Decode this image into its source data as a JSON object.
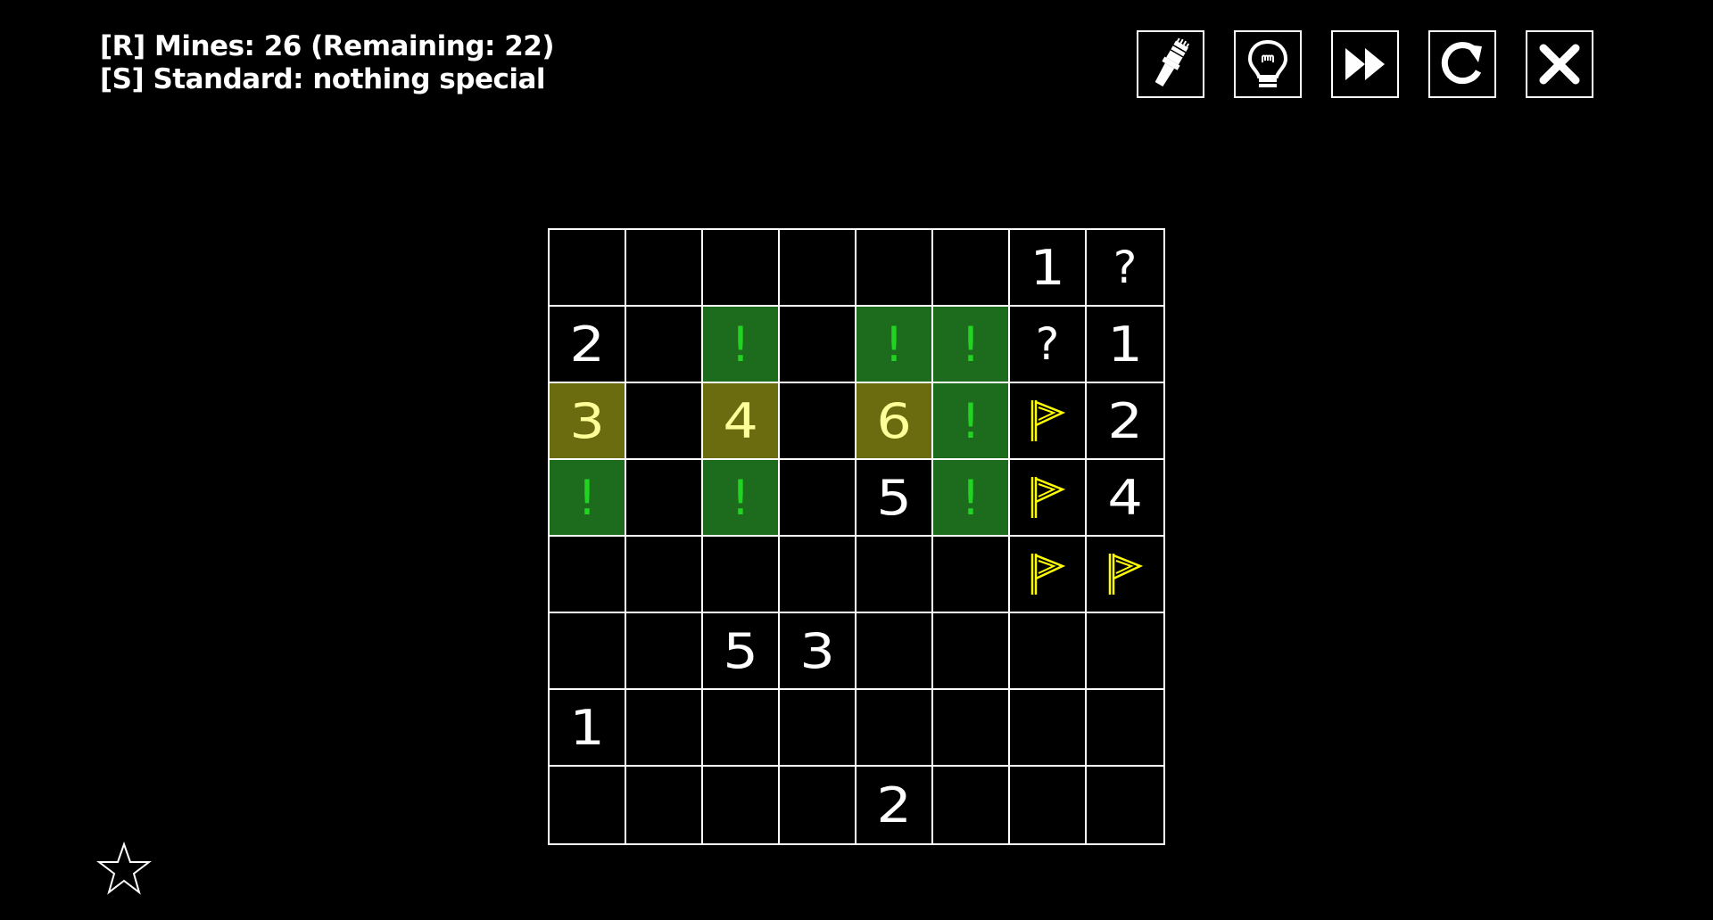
{
  "info": {
    "line1": "[R] Mines: 26 (Remaining: 22)",
    "line2": "[S] Standard: nothing special"
  },
  "toolbar": [
    {
      "name": "brush-button",
      "icon": "brush-icon"
    },
    {
      "name": "hint-button",
      "icon": "lightbulb-icon"
    },
    {
      "name": "skip-button",
      "icon": "fast-forward-icon"
    },
    {
      "name": "restart-button",
      "icon": "restart-icon"
    },
    {
      "name": "close-button",
      "icon": "close-icon"
    }
  ],
  "colors": {
    "background": "#000000",
    "grid": "#ffffff",
    "highlight_green": "#1d6b1d",
    "highlight_olive": "#6b6b10",
    "mark_green": "#22d422",
    "flag_yellow": "#ffff00",
    "number_highlight": "#ffff99"
  },
  "board": {
    "rows": 8,
    "cols": 8,
    "cells": [
      [
        {
          "t": ""
        },
        {
          "t": ""
        },
        {
          "t": ""
        },
        {
          "t": ""
        },
        {
          "t": ""
        },
        {
          "t": ""
        },
        {
          "t": "num",
          "v": "1"
        },
        {
          "t": "q",
          "v": "?"
        }
      ],
      [
        {
          "t": "num",
          "v": "2"
        },
        {
          "t": ""
        },
        {
          "t": "mark",
          "v": "!",
          "bg": "green"
        },
        {
          "t": ""
        },
        {
          "t": "mark",
          "v": "!",
          "bg": "green"
        },
        {
          "t": "mark",
          "v": "!",
          "bg": "green"
        },
        {
          "t": "q",
          "v": "?"
        },
        {
          "t": "num",
          "v": "1"
        }
      ],
      [
        {
          "t": "num",
          "v": "3",
          "bg": "olive"
        },
        {
          "t": ""
        },
        {
          "t": "num",
          "v": "4",
          "bg": "olive"
        },
        {
          "t": ""
        },
        {
          "t": "num",
          "v": "6",
          "bg": "olive"
        },
        {
          "t": "mark",
          "v": "!",
          "bg": "green"
        },
        {
          "t": "flag"
        },
        {
          "t": "num",
          "v": "2"
        }
      ],
      [
        {
          "t": "mark",
          "v": "!",
          "bg": "green"
        },
        {
          "t": ""
        },
        {
          "t": "mark",
          "v": "!",
          "bg": "green"
        },
        {
          "t": ""
        },
        {
          "t": "num",
          "v": "5"
        },
        {
          "t": "mark",
          "v": "!",
          "bg": "green"
        },
        {
          "t": "flag"
        },
        {
          "t": "num",
          "v": "4"
        }
      ],
      [
        {
          "t": ""
        },
        {
          "t": ""
        },
        {
          "t": ""
        },
        {
          "t": ""
        },
        {
          "t": ""
        },
        {
          "t": ""
        },
        {
          "t": "flag"
        },
        {
          "t": "flag"
        }
      ],
      [
        {
          "t": ""
        },
        {
          "t": ""
        },
        {
          "t": "num",
          "v": "5"
        },
        {
          "t": "num",
          "v": "3"
        },
        {
          "t": ""
        },
        {
          "t": ""
        },
        {
          "t": ""
        },
        {
          "t": ""
        }
      ],
      [
        {
          "t": "num",
          "v": "1"
        },
        {
          "t": ""
        },
        {
          "t": ""
        },
        {
          "t": ""
        },
        {
          "t": ""
        },
        {
          "t": ""
        },
        {
          "t": ""
        },
        {
          "t": ""
        }
      ],
      [
        {
          "t": ""
        },
        {
          "t": ""
        },
        {
          "t": ""
        },
        {
          "t": ""
        },
        {
          "t": "num",
          "v": "2"
        },
        {
          "t": ""
        },
        {
          "t": ""
        },
        {
          "t": ""
        }
      ]
    ]
  },
  "star": {
    "icon": "star-icon"
  }
}
